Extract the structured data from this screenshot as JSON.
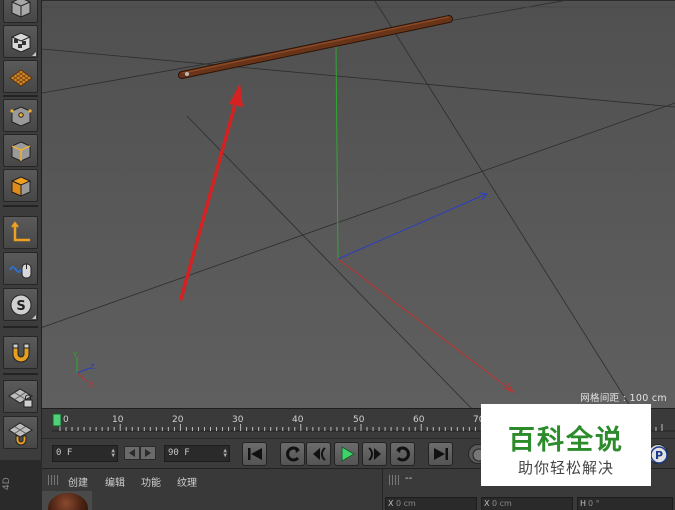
{
  "viewport": {
    "grid_spacing_label": "网格间距 : 100 cm",
    "axis_gizmo": {
      "y": "Y",
      "z": "Z",
      "x": "X"
    }
  },
  "left_toolbar": {
    "tools": [
      {
        "icon": "cube-top-icon"
      },
      {
        "icon": "checker-cube-icon"
      },
      {
        "icon": "texture-grid-icon"
      },
      {
        "icon": "points-mode-icon"
      },
      {
        "icon": "edges-mode-icon"
      },
      {
        "icon": "polygons-mode-icon"
      },
      {
        "icon": "axis-mode-icon"
      },
      {
        "icon": "tweak-mouse-icon"
      },
      {
        "icon": "solo-s-icon"
      },
      {
        "icon": "magnet-icon"
      },
      {
        "icon": "workplane-lock-icon"
      },
      {
        "icon": "workplane-snap-icon"
      }
    ]
  },
  "timeline": {
    "ticks": [
      "0",
      "10",
      "20",
      "30",
      "40",
      "50",
      "60",
      "70"
    ]
  },
  "transport": {
    "current_frame": "0 F",
    "end_frame": "90 F"
  },
  "bottom_panel": {
    "material_menu": [
      "创建",
      "编辑",
      "功能",
      "纹理"
    ],
    "coord_header": "--",
    "coord_fields": [
      {
        "axis": "X",
        "value": "0 cm"
      },
      {
        "axis": "X",
        "value": "0 cm"
      },
      {
        "axis": "H",
        "value": "0 °"
      }
    ],
    "edge_label": "4D"
  },
  "watermark": {
    "title": "百科全说",
    "subtitle": "助你轻松解决"
  },
  "colors": {
    "viewport_bg": "#555555",
    "axis_x": "#c03030",
    "axis_y": "#2fa82f",
    "axis_z": "#2a3fc0",
    "rod": "#5a2a14",
    "arrow": "#d42222",
    "watermark_green": "#2c8c2c"
  }
}
